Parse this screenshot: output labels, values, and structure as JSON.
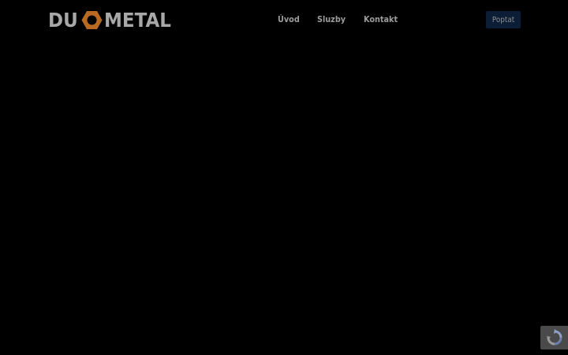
{
  "logo": {
    "part1": "DU",
    "part2": "METAL",
    "icon": "hex-nut-icon",
    "icon_color": "#b86a22"
  },
  "nav": {
    "items": [
      {
        "label": "Úvod"
      },
      {
        "label": "Sluzby"
      },
      {
        "label": "Kontakt"
      }
    ]
  },
  "cta": {
    "label": "Poptat",
    "background": "#0c1e36"
  },
  "recaptcha": {
    "icon": "recaptcha-icon"
  },
  "colors": {
    "page_background": "#000000",
    "nav_text": "#9c9c9c",
    "logo_text": "#a8a8a8"
  }
}
